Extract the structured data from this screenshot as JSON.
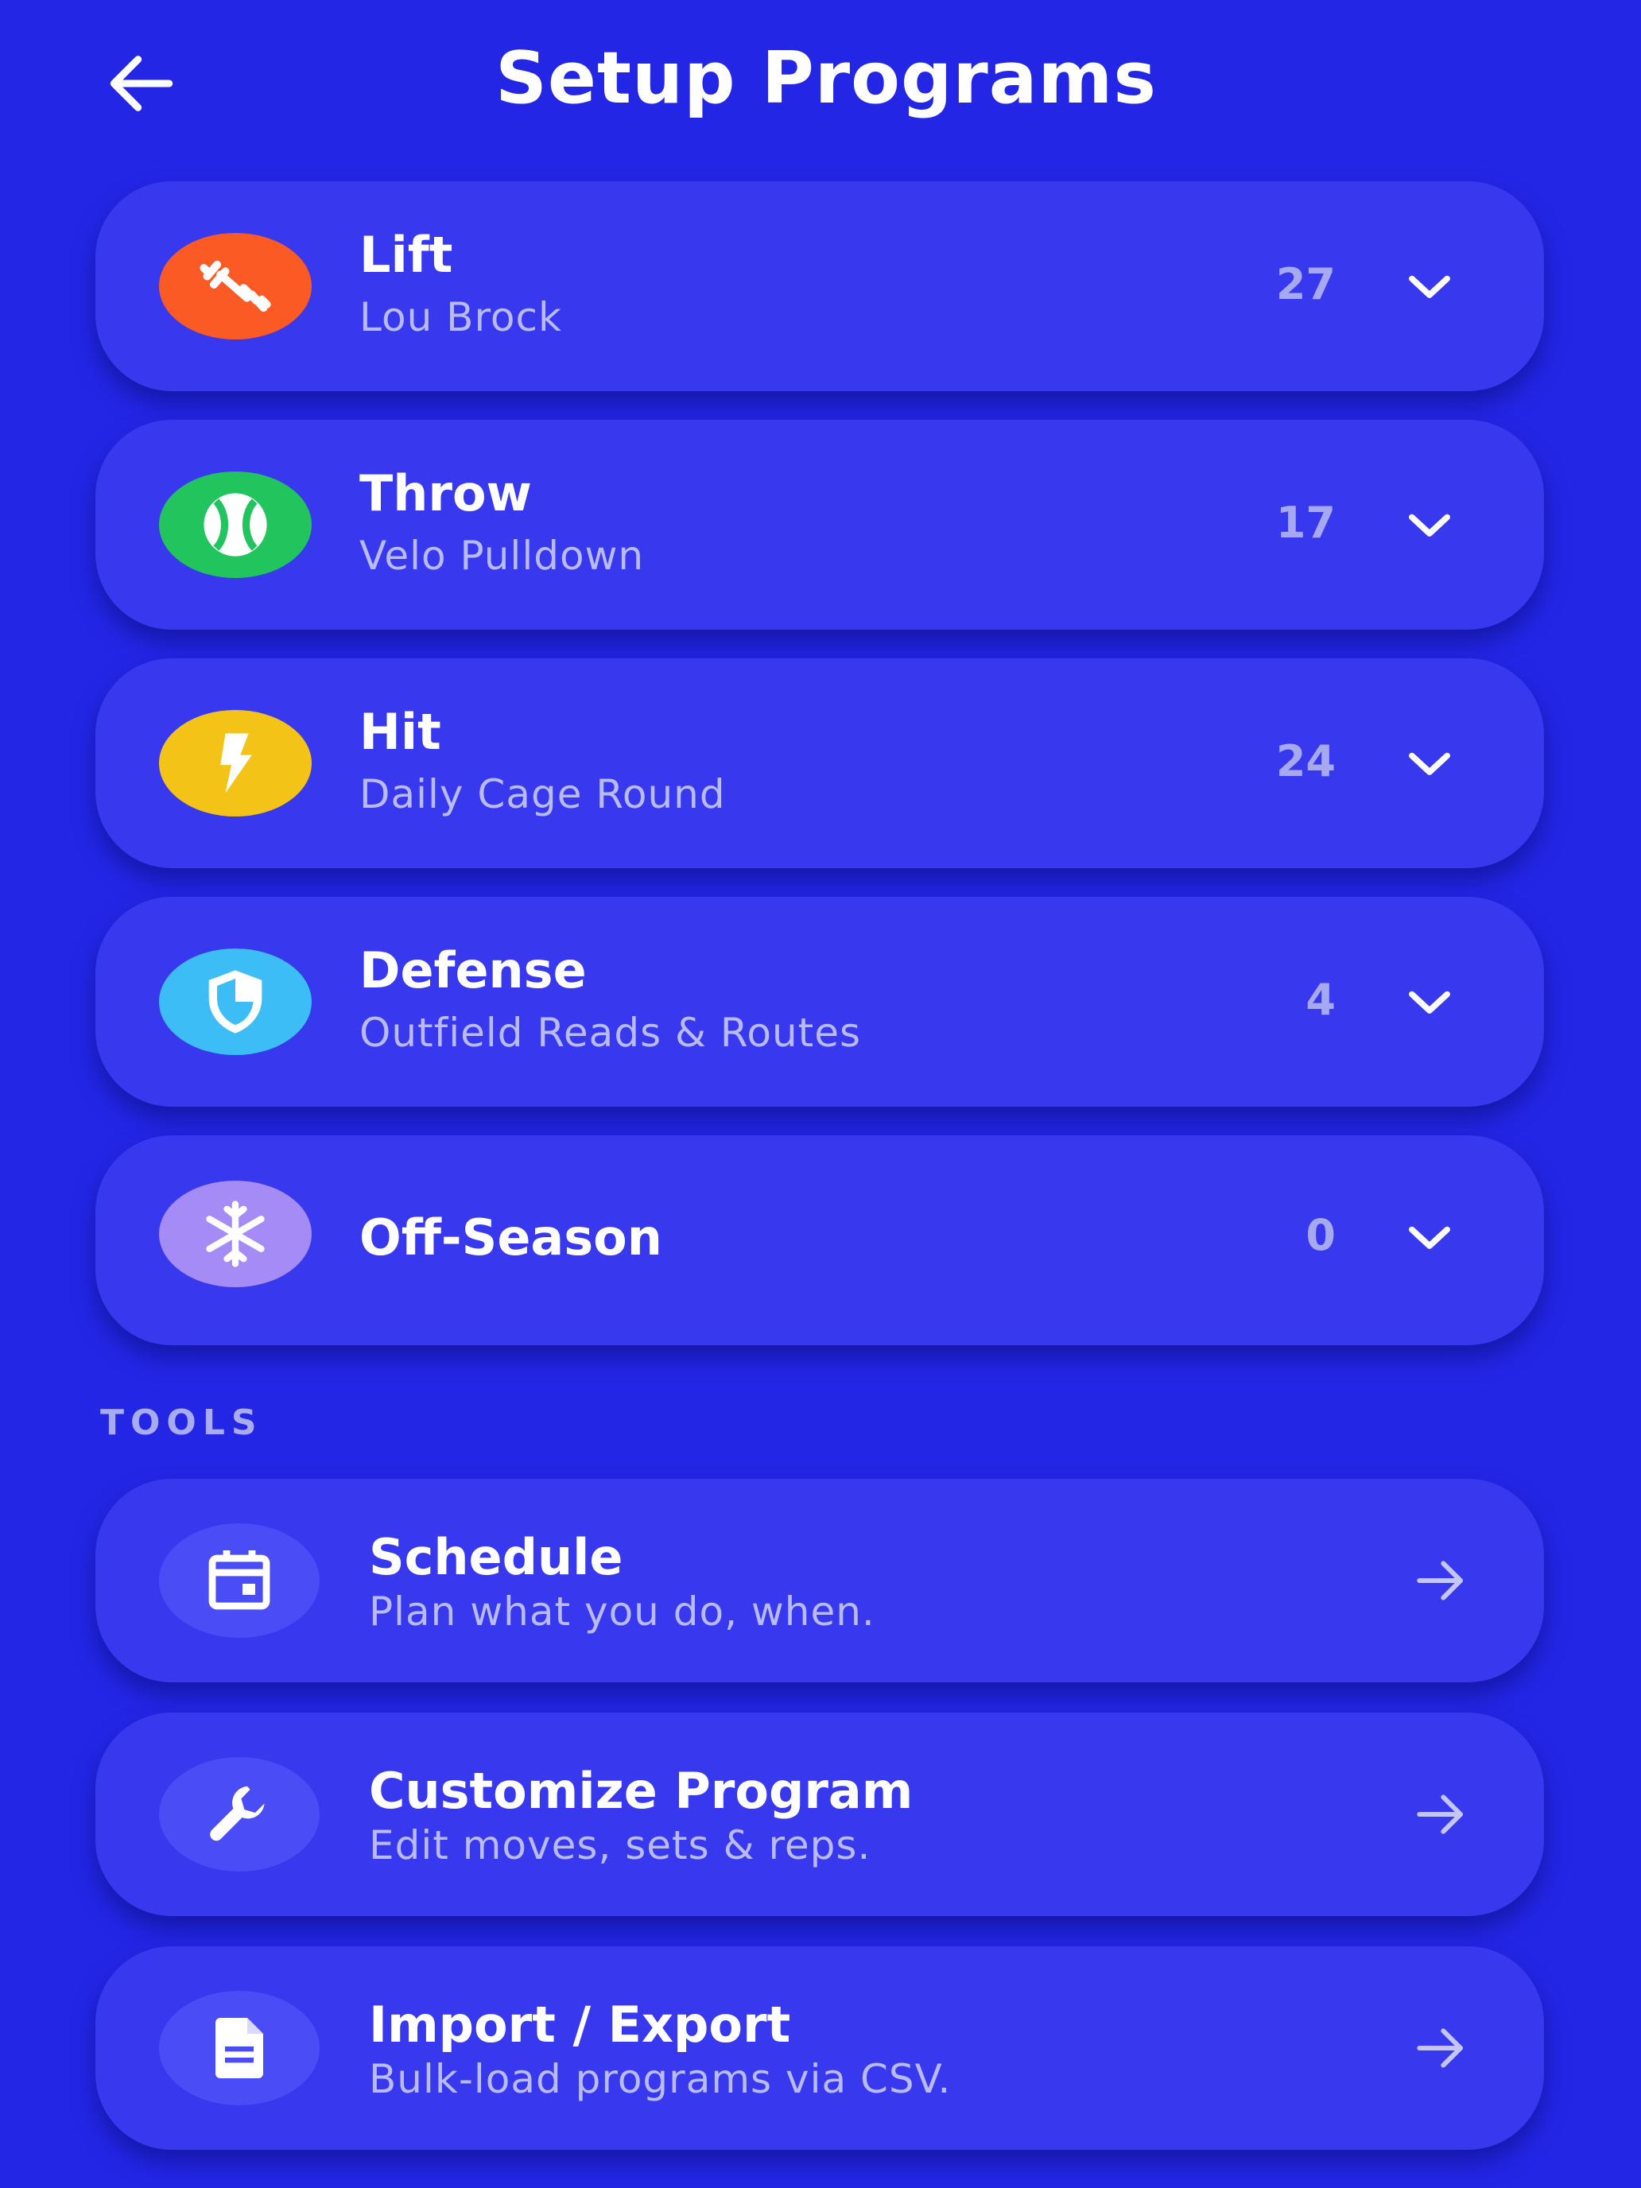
{
  "header": {
    "title": "Setup Programs",
    "back_icon": "arrow-left-icon"
  },
  "programs": [
    {
      "title": "Lift",
      "subtitle": "Lou Brock",
      "count": "27",
      "icon": "barbell-icon",
      "color": "#fb5a24"
    },
    {
      "title": "Throw",
      "subtitle": "Velo Pulldown",
      "count": "17",
      "icon": "baseball-icon",
      "color": "#22c45e"
    },
    {
      "title": "Hit",
      "subtitle": "Daily Cage Round",
      "count": "24",
      "icon": "lightning-icon",
      "color": "#f4c317"
    },
    {
      "title": "Defense",
      "subtitle": "Outfield Reads & Routes",
      "count": "4",
      "icon": "shield-icon",
      "color": "#3cbdf6"
    },
    {
      "title": "Off-Season",
      "subtitle": "",
      "count": "0",
      "icon": "snowflake-icon",
      "color": "#a48bf5"
    }
  ],
  "tools_section": {
    "label": "TOOLS",
    "items": [
      {
        "title": "Schedule",
        "subtitle": "Plan what you do, when.",
        "icon": "calendar-icon"
      },
      {
        "title": "Customize Program",
        "subtitle": "Edit moves, sets & reps.",
        "icon": "wrench-icon"
      },
      {
        "title": "Import / Export",
        "subtitle": "Bulk-load programs via CSV.",
        "icon": "document-icon"
      }
    ]
  },
  "colors": {
    "background": "#2426e6",
    "card": "#3839ef",
    "muted_text": "#b9bbf6"
  }
}
